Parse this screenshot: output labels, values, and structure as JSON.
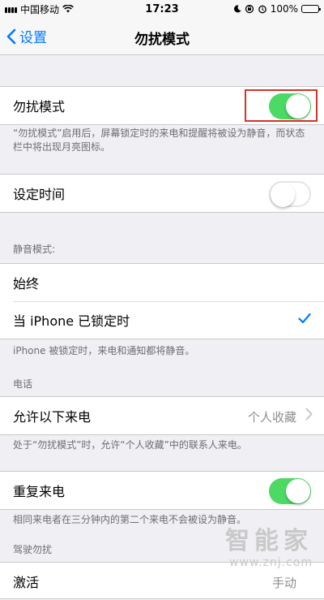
{
  "status_bar": {
    "carrier": "中国移动",
    "time": "17:23",
    "battery": "100%"
  },
  "nav": {
    "back_label": "设置",
    "title": "勿扰模式"
  },
  "dnd": {
    "label": "勿扰模式",
    "toggle_on": true,
    "footer": "“勿扰模式”启用后，屏幕锁定时的来电和提醒将被设为静音，而状态栏中将出现月亮图标。"
  },
  "scheduled": {
    "label": "设定时间",
    "toggle_on": false
  },
  "silence": {
    "header": "静音模式:",
    "options": [
      "始终",
      "当 iPhone 已锁定时"
    ],
    "selected_index": 1,
    "footer": "iPhone 被锁定时，来电和通知都将静音。"
  },
  "phone": {
    "header": "电话",
    "allow_label": "允许以下来电",
    "allow_value": "个人收藏",
    "footer": "处于“勿扰模式”时，允许“个人收藏”中的联系人来电。"
  },
  "repeated": {
    "label": "重复来电",
    "toggle_on": true,
    "footer": "相同来电者在三分钟内的第二个来电不会被设为静音。"
  },
  "driving": {
    "header": "驾驶勿扰",
    "activate_label": "激活",
    "activate_value": "手动"
  },
  "watermark": {
    "title": "智能家",
    "url": "www.znj.com"
  },
  "colors": {
    "accent": "#007aff",
    "toggle_on": "#4cd964",
    "highlight": "#d0352b"
  }
}
